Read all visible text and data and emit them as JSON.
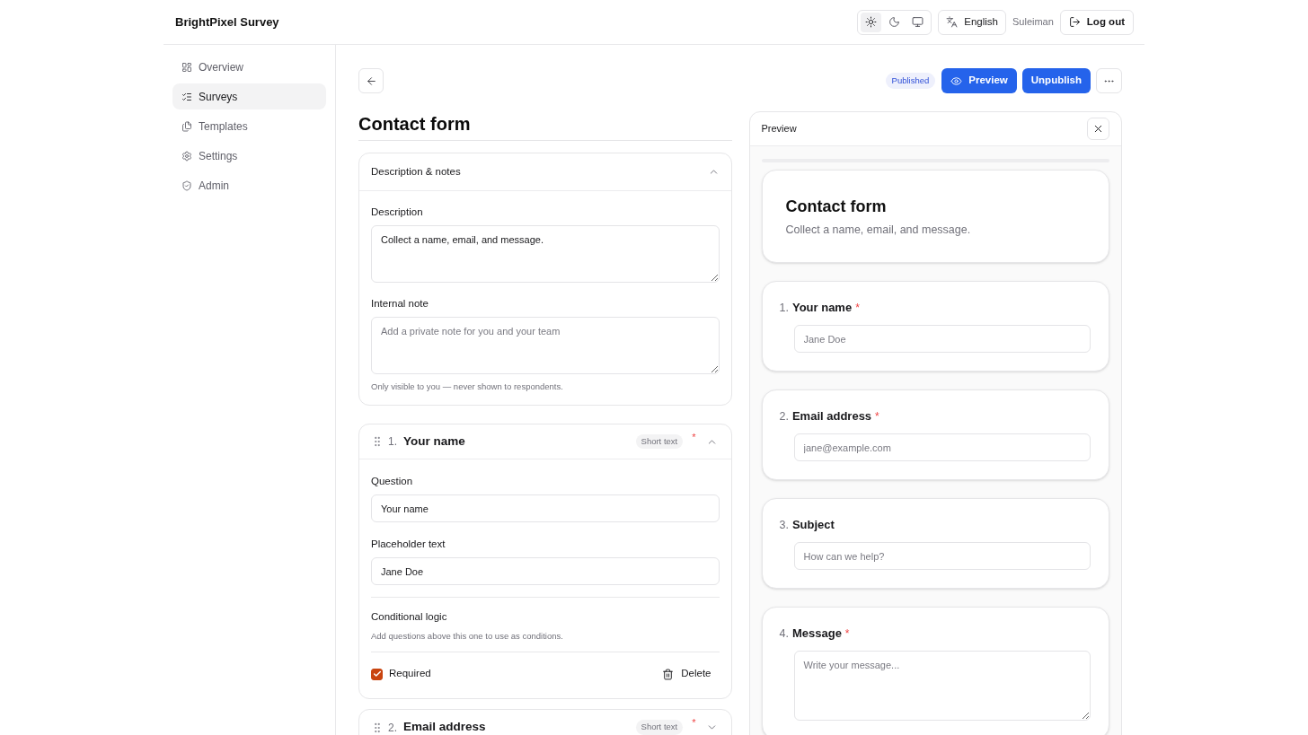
{
  "header": {
    "brand": "BrightPixel Survey",
    "theme_options": [
      {
        "kind": "light",
        "selected": true
      },
      {
        "kind": "dark",
        "selected": false
      },
      {
        "kind": "system",
        "selected": false
      }
    ],
    "language": "English",
    "user": "Suleiman",
    "logout": "Log out"
  },
  "sidebar": {
    "items": [
      {
        "label": "Overview",
        "selected": false
      },
      {
        "label": "Surveys",
        "selected": true
      },
      {
        "label": "Templates",
        "selected": false
      },
      {
        "label": "Settings",
        "selected": false
      },
      {
        "label": "Admin",
        "selected": false
      }
    ]
  },
  "toolbar": {
    "status": "Published",
    "actions": [
      {
        "kind": "preview",
        "label": "Preview"
      },
      {
        "kind": "unpublish",
        "label": "Unpublish"
      }
    ]
  },
  "required_mark": "*",
  "editor": {
    "title": "Contact form",
    "details": {
      "title": "Description & notes",
      "expanded": true,
      "description": {
        "label": "Description",
        "value": "Collect a name, email, and message."
      },
      "internal_note": {
        "label": "Internal note",
        "placeholder": "Add a private note for you and your team",
        "hint": "Only visible to you — never shown to respondents."
      }
    },
    "questions": [
      {
        "number": "1.",
        "title": "Your name",
        "type_label": "Short text",
        "required": true,
        "expanded": true,
        "question": {
          "label": "Question",
          "value": "Your name"
        },
        "placeholder_text": {
          "label": "Placeholder text",
          "value": "Jane Doe"
        },
        "logic": {
          "label": "Conditional logic",
          "hint": "Add questions above this one to use as conditions."
        },
        "required_label": "Required",
        "delete": "Delete"
      },
      {
        "number": "2.",
        "title": "Email address",
        "type_label": "Short text",
        "required": true,
        "expanded": false
      }
    ]
  },
  "preview": {
    "title": "Preview",
    "form": {
      "title": "Contact form",
      "description": "Collect a name, email, and message."
    },
    "questions": [
      {
        "number": "1.",
        "title": "Your name",
        "required": true,
        "kind": "short",
        "placeholder": "Jane Doe"
      },
      {
        "number": "2.",
        "title": "Email address",
        "required": true,
        "kind": "short",
        "placeholder": "jane@example.com"
      },
      {
        "number": "3.",
        "title": "Subject",
        "required": false,
        "kind": "short",
        "placeholder": "How can we help?"
      },
      {
        "number": "4.",
        "title": "Message",
        "required": true,
        "kind": "long",
        "placeholder": "Write your message..."
      }
    ]
  }
}
